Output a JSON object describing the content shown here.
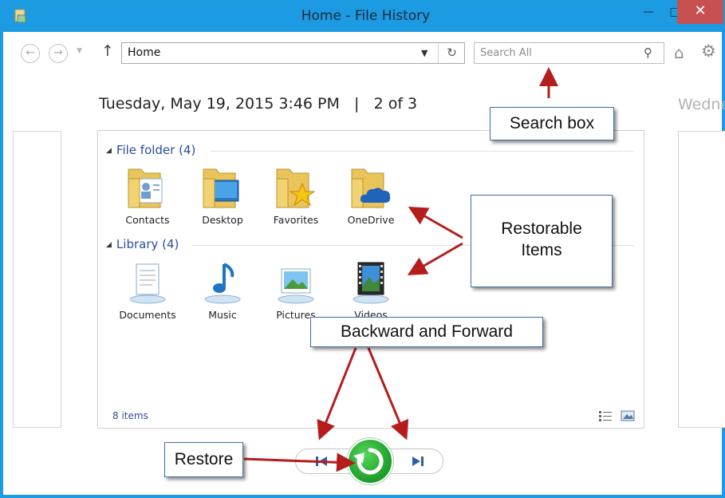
{
  "window": {
    "title": "Home - File History"
  },
  "toolbar": {
    "address_value": "Home",
    "search_placeholder": "Search All"
  },
  "header": {
    "date": "Tuesday, May 19, 2015 3:46 PM",
    "separator": "|",
    "position": "2 of 3",
    "next_date_partial": "Wedne"
  },
  "groups": [
    {
      "label": "File folder (4)",
      "items": [
        {
          "label": "Contacts",
          "icon": "contacts-folder-icon"
        },
        {
          "label": "Desktop",
          "icon": "desktop-folder-icon"
        },
        {
          "label": "Favorites",
          "icon": "favorites-folder-icon"
        },
        {
          "label": "OneDrive",
          "icon": "onedrive-folder-icon"
        }
      ]
    },
    {
      "label": "Library (4)",
      "items": [
        {
          "label": "Documents",
          "icon": "documents-library-icon"
        },
        {
          "label": "Music",
          "icon": "music-library-icon"
        },
        {
          "label": "Pictures",
          "icon": "pictures-library-icon"
        },
        {
          "label": "Videos",
          "icon": "videos-library-icon"
        }
      ]
    }
  ],
  "status": {
    "count": "8 items"
  },
  "annotations": {
    "search_box": "Search box",
    "restorable_line1": "Restorable",
    "restorable_line2": "Items",
    "backward_forward": "Backward and Forward",
    "restore": "Restore"
  },
  "colors": {
    "titlebar": "#1c9be3",
    "close": "#c75050",
    "link_blue": "#2c4e99",
    "restore_green": "#2bb03a",
    "arrow_red": "#b51d1d"
  }
}
